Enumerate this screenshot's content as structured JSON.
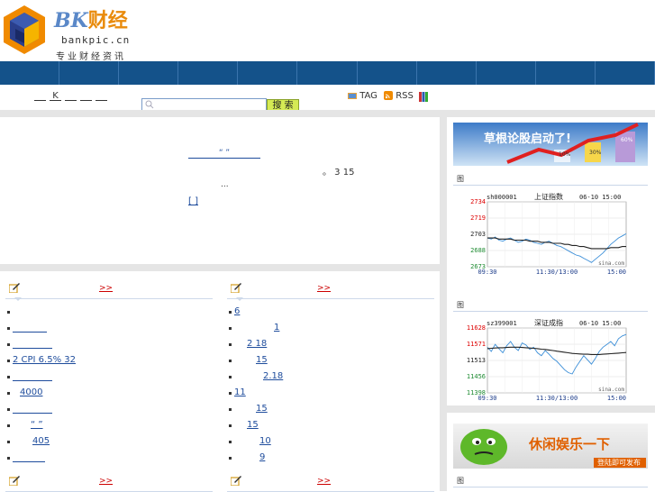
{
  "header": {
    "brand_latin": "BK",
    "brand_cn": "财经",
    "domain": "bankpic.cn",
    "slogan": "专业财经资讯",
    "nav_cells": 11
  },
  "subnav": {
    "links": [
      "",
      "K",
      "",
      "",
      ""
    ],
    "search_placeholder": "",
    "search_button": "搜 索",
    "tag_label": "TAG",
    "rss_label": "RSS"
  },
  "featured": {
    "title": "“ ”",
    "text": "。       3 15",
    "ellipsis": "...",
    "more": "[        ]"
  },
  "columns": {
    "left": {
      "more": ">>",
      "items": [
        "",
        "",
        "",
        "2   CPI   6.5%   32",
        "",
        "4000",
        "",
        "“   ”",
        "405",
        ""
      ]
    },
    "right": {
      "more": ">>",
      "items": [
        "6",
        "1",
        "2 18",
        "15",
        "2.18",
        "11",
        "15",
        "15",
        "10",
        "9"
      ]
    },
    "left_bottom_more": ">>",
    "right_bottom_more": ">>"
  },
  "sidebar": {
    "banner1_text": "草根论股启动了!",
    "banner1_values": [
      "10%",
      "30%",
      "60%"
    ],
    "banner2_text": "休闲娱乐一下",
    "banner2_sub": "登陆即可发布",
    "sec_icon": "图"
  },
  "chart_data": [
    {
      "type": "line",
      "code": "sh000001",
      "name": "上证指数",
      "datetime": "06-10 15:00",
      "yticks": [
        "2734",
        "2719",
        "2703",
        "2688",
        "2673"
      ],
      "ylim": [
        2673,
        2734
      ],
      "xticks": [
        "09:30",
        "11:30/13:00",
        "15:00"
      ],
      "source": "sina.com",
      "series": [
        {
          "values": [
            2700,
            2699,
            2701,
            2698,
            2697,
            2699,
            2700,
            2698,
            2696,
            2697,
            2699,
            2698,
            2696,
            2695,
            2694,
            2696,
            2697,
            2695,
            2693,
            2692,
            2690,
            2688,
            2686,
            2684,
            2683,
            2681,
            2679,
            2677,
            2680,
            2683,
            2686,
            2690,
            2694,
            2697,
            2700,
            2702,
            2704
          ]
        },
        {
          "values": [
            2700,
            2700,
            2700,
            2699,
            2699,
            2699,
            2699,
            2698,
            2698,
            2698,
            2698,
            2697,
            2697,
            2697,
            2696,
            2696,
            2696,
            2695,
            2695,
            2695,
            2694,
            2694,
            2693,
            2693,
            2692,
            2692,
            2691,
            2690,
            2690,
            2690,
            2690,
            2690,
            2691,
            2691,
            2691,
            2692,
            2692
          ]
        }
      ]
    },
    {
      "type": "line",
      "code": "sz399001",
      "name": "深证成指",
      "datetime": "06-10 15:00",
      "yticks": [
        "11628",
        "11571",
        "11513",
        "11456",
        "11398"
      ],
      "ylim": [
        11398,
        11628
      ],
      "xticks": [
        "09:30",
        "11:30/13:00",
        "15:00"
      ],
      "source": "sina.com",
      "series": [
        {
          "values": [
            11560,
            11545,
            11570,
            11555,
            11540,
            11565,
            11580,
            11560,
            11548,
            11575,
            11568,
            11552,
            11560,
            11540,
            11530,
            11548,
            11535,
            11520,
            11510,
            11495,
            11480,
            11470,
            11465,
            11490,
            11510,
            11530,
            11515,
            11500,
            11520,
            11545,
            11560,
            11570,
            11580,
            11565,
            11590,
            11600,
            11605
          ]
        },
        {
          "values": [
            11555,
            11556,
            11557,
            11558,
            11558,
            11559,
            11560,
            11560,
            11560,
            11559,
            11558,
            11557,
            11556,
            11555,
            11553,
            11552,
            11550,
            11548,
            11546,
            11544,
            11542,
            11540,
            11538,
            11537,
            11536,
            11535,
            11535,
            11534,
            11534,
            11534,
            11535,
            11536,
            11537,
            11538,
            11539,
            11540,
            11541
          ]
        }
      ]
    }
  ]
}
